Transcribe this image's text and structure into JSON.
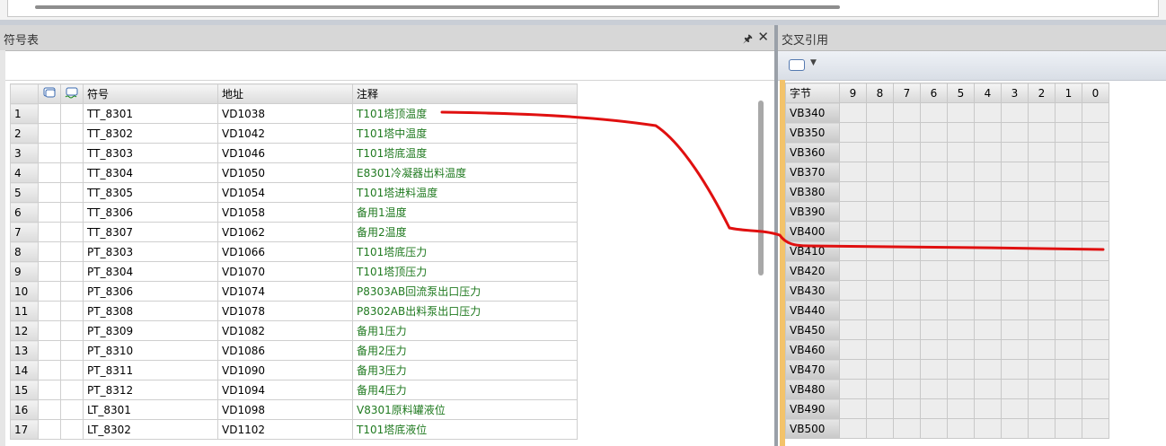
{
  "symbol_pane": {
    "title": "符号表",
    "pin_icon": "pin-icon",
    "close_icon": "close-icon",
    "columns": [
      "符号",
      "地址",
      "注释"
    ],
    "rows": [
      {
        "num": "1",
        "symbol": "TT_8301",
        "address": "VD1038",
        "comment": "T101塔顶温度"
      },
      {
        "num": "2",
        "symbol": "TT_8302",
        "address": "VD1042",
        "comment": "T101塔中温度"
      },
      {
        "num": "3",
        "symbol": "TT_8303",
        "address": "VD1046",
        "comment": "T101塔底温度"
      },
      {
        "num": "4",
        "symbol": "TT_8304",
        "address": "VD1050",
        "comment": "E8301冷凝器出料温度"
      },
      {
        "num": "5",
        "symbol": "TT_8305",
        "address": "VD1054",
        "comment": "T101塔进料温度"
      },
      {
        "num": "6",
        "symbol": "TT_8306",
        "address": "VD1058",
        "comment": "备用1温度"
      },
      {
        "num": "7",
        "symbol": "TT_8307",
        "address": "VD1062",
        "comment": "备用2温度"
      },
      {
        "num": "8",
        "symbol": "PT_8303",
        "address": "VD1066",
        "comment": "T101塔底压力"
      },
      {
        "num": "9",
        "symbol": "PT_8304",
        "address": "VD1070",
        "comment": "T101塔顶压力"
      },
      {
        "num": "10",
        "symbol": "PT_8306",
        "address": "VD1074",
        "comment": "P8303AB回流泵出口压力"
      },
      {
        "num": "11",
        "symbol": "PT_8308",
        "address": "VD1078",
        "comment": "P8302AB出料泵出口压力"
      },
      {
        "num": "12",
        "symbol": "PT_8309",
        "address": "VD1082",
        "comment": "备用1压力"
      },
      {
        "num": "13",
        "symbol": "PT_8310",
        "address": "VD1086",
        "comment": "备用2压力"
      },
      {
        "num": "14",
        "symbol": "PT_8311",
        "address": "VD1090",
        "comment": "备用3压力"
      },
      {
        "num": "15",
        "symbol": "PT_8312",
        "address": "VD1094",
        "comment": "备用4压力"
      },
      {
        "num": "16",
        "symbol": "LT_8301",
        "address": "VD1098",
        "comment": "V8301原料罐液位"
      },
      {
        "num": "17",
        "symbol": "LT_8302",
        "address": "VD1102",
        "comment": "T101塔底液位"
      }
    ]
  },
  "xref_pane": {
    "title": "交叉引用",
    "toolbar_icon": "tag-icon",
    "byte_header": "字节",
    "bit_headers": [
      "9",
      "8",
      "7",
      "6",
      "5",
      "4",
      "3",
      "2",
      "1",
      "0"
    ],
    "rows": [
      "VB340",
      "VB350",
      "VB360",
      "VB370",
      "VB380",
      "VB390",
      "VB400",
      "VB410",
      "VB420",
      "VB430",
      "VB440",
      "VB450",
      "VB460",
      "VB470",
      "VB480",
      "VB490",
      "VB500"
    ]
  },
  "colors": {
    "comment_text": "#207a20",
    "annotation_stroke": "#e01010",
    "xref_border": "#f3c36a"
  }
}
